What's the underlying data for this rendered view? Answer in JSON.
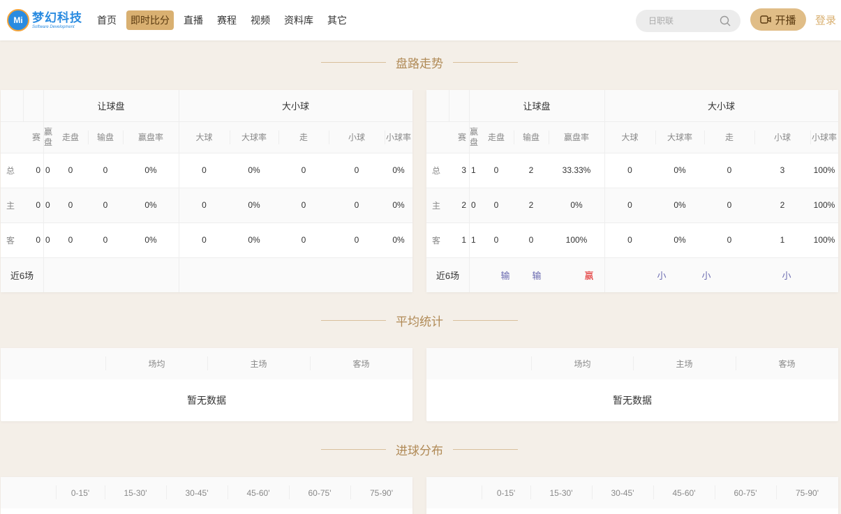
{
  "brand": {
    "badge": "Mi",
    "name": "梦幻科技",
    "tagline": "Software Development"
  },
  "nav": [
    "首页",
    "即时比分",
    "直播",
    "赛程",
    "视频",
    "资料库",
    "其它"
  ],
  "nav_active_index": 1,
  "search": {
    "placeholder": "日职联"
  },
  "live_button": "开播",
  "login": "登录",
  "sections": {
    "trend": "盘路走势",
    "average": "平均统计",
    "goals": "进球分布"
  },
  "trend": {
    "group_handicap": "让球盘",
    "group_ou": "大小球",
    "headers": [
      "赛",
      "赢盘",
      "走盘",
      "输盘",
      "赢盘率",
      "大球",
      "大球率",
      "走",
      "小球",
      "小球率"
    ],
    "row_labels": [
      "总",
      "主",
      "客"
    ],
    "recent_label": "近6场",
    "left": {
      "rows": [
        [
          "0",
          "0",
          "0",
          "0",
          "0%",
          "0",
          "0%",
          "0",
          "0",
          "0%"
        ],
        [
          "0",
          "0",
          "0",
          "0",
          "0%",
          "0",
          "0%",
          "0",
          "0",
          "0%"
        ],
        [
          "0",
          "0",
          "0",
          "0",
          "0%",
          "0",
          "0%",
          "0",
          "0",
          "0%"
        ]
      ],
      "recent_handicap": [],
      "recent_ou": []
    },
    "right": {
      "rows": [
        [
          "3",
          "1",
          "0",
          "2",
          "33.33%",
          "0",
          "0%",
          "0",
          "3",
          "100%"
        ],
        [
          "2",
          "0",
          "0",
          "2",
          "0%",
          "0",
          "0%",
          "0",
          "2",
          "100%"
        ],
        [
          "1",
          "1",
          "0",
          "0",
          "100%",
          "0",
          "0%",
          "0",
          "1",
          "100%"
        ]
      ],
      "recent_handicap": [
        "输",
        "输",
        "赢"
      ],
      "recent_ou": [
        "小",
        "小",
        "小"
      ]
    }
  },
  "average": {
    "headers": [
      "场均",
      "主场",
      "客场"
    ],
    "empty": "暂无数据"
  },
  "goals": {
    "headers": [
      "0-15'",
      "15-30'",
      "30-45'",
      "45-60'",
      "60-75'",
      "75-90'"
    ]
  },
  "colors": {
    "accent": "#d9b071",
    "win": "#e02020",
    "lose": "#6a6ab0",
    "title": "#b08a56"
  }
}
